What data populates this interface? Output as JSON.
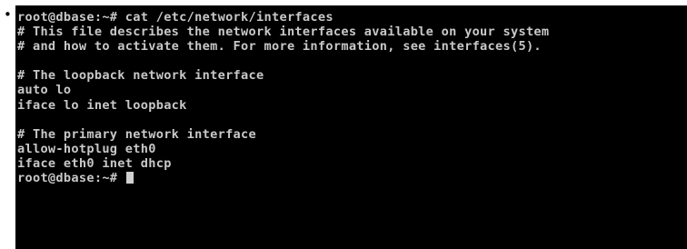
{
  "bullet": "•",
  "terminal": {
    "lines": [
      "root@dbase:~# cat /etc/network/interfaces",
      "# This file describes the network interfaces available on your system",
      "# and how to activate them. For more information, see interfaces(5).",
      "",
      "# The loopback network interface",
      "auto lo",
      "iface lo inet loopback",
      "",
      "# The primary network interface",
      "allow-hotplug eth0",
      "iface eth0 inet dhcp"
    ],
    "prompt": "root@dbase:~# ",
    "colors": {
      "background": "#000000",
      "text": "#c8c8c8"
    }
  }
}
